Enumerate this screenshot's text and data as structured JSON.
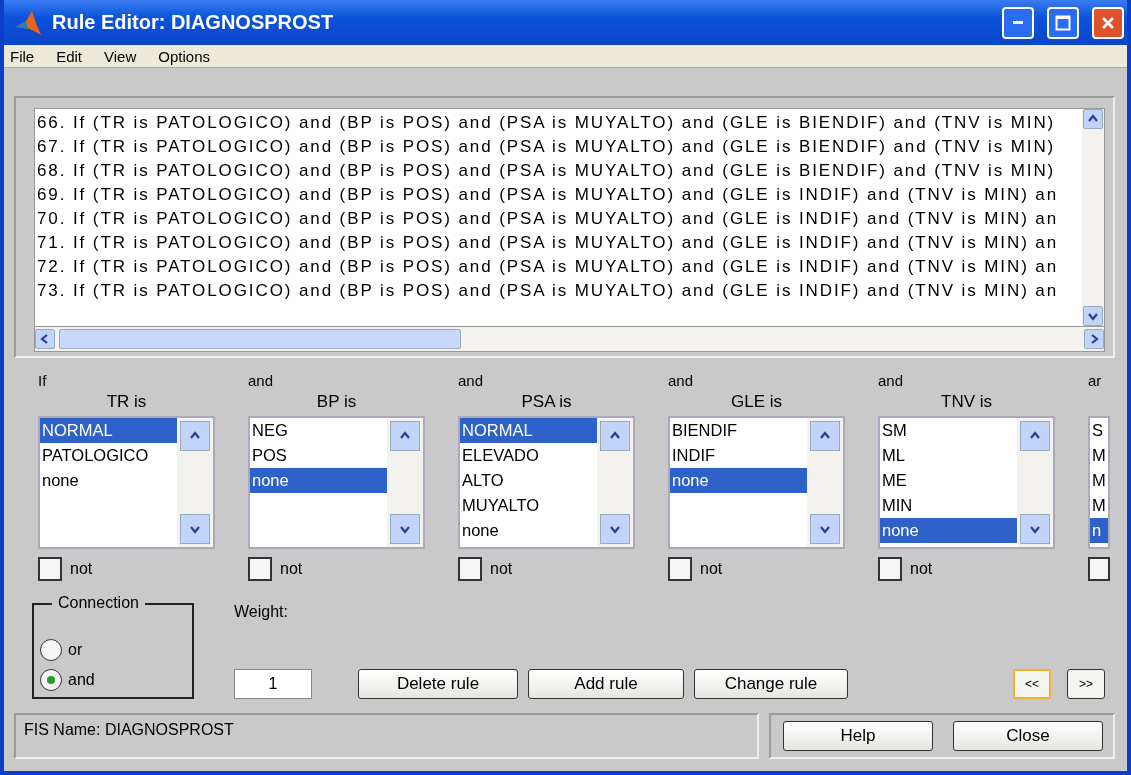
{
  "window": {
    "title": "Rule Editor: DIAGNOSPROST"
  },
  "menu": [
    "File",
    "Edit",
    "View",
    "Options"
  ],
  "rules": [
    "66. If (TR is PATOLOGICO) and (BP is POS) and (PSA is MUYALTO) and (GLE is BIENDIF) and (TNV is MIN)",
    "67. If (TR is PATOLOGICO) and (BP is POS) and (PSA is MUYALTO) and (GLE is BIENDIF) and (TNV is MIN)",
    "68. If (TR is PATOLOGICO) and (BP is POS) and (PSA is MUYALTO) and (GLE is BIENDIF) and (TNV is MIN)",
    "69. If (TR is PATOLOGICO) and (BP is POS) and (PSA is MUYALTO) and (GLE is INDIF) and (TNV is MIN) an",
    "70. If (TR is PATOLOGICO) and (BP is POS) and (PSA is MUYALTO) and (GLE is INDIF) and (TNV is MIN) an",
    "71. If (TR is PATOLOGICO) and (BP is POS) and (PSA is MUYALTO) and (GLE is INDIF) and (TNV is MIN) an",
    "72. If (TR is PATOLOGICO) and (BP is POS) and (PSA is MUYALTO) and (GLE is INDIF) and (TNV is MIN) an",
    "73. If (TR is PATOLOGICO) and (BP is POS) and (PSA is MUYALTO) and (GLE is INDIF) and (TNV is MIN) an"
  ],
  "antecedents": [
    {
      "connector": "If",
      "label": "TR is",
      "items": [
        {
          "text": "NORMAL",
          "selected": true
        },
        {
          "text": "PATOLOGICO",
          "selected": false
        },
        {
          "text": "none",
          "selected": false
        }
      ],
      "negate": {
        "label": "not",
        "checked": false
      }
    },
    {
      "connector": "and",
      "label": "BP is",
      "items": [
        {
          "text": "NEG",
          "selected": false
        },
        {
          "text": "POS",
          "selected": false
        },
        {
          "text": "none",
          "selected": true
        }
      ],
      "negate": {
        "label": "not",
        "checked": false
      }
    },
    {
      "connector": "and",
      "label": "PSA is",
      "items": [
        {
          "text": "NORMAL",
          "selected": true
        },
        {
          "text": "ELEVADO",
          "selected": false
        },
        {
          "text": "ALTO",
          "selected": false
        },
        {
          "text": "MUYALTO",
          "selected": false
        },
        {
          "text": "none",
          "selected": false
        }
      ],
      "negate": {
        "label": "not",
        "checked": false
      }
    },
    {
      "connector": "and",
      "label": "GLE is",
      "items": [
        {
          "text": "BIENDIF",
          "selected": false
        },
        {
          "text": "INDIF",
          "selected": false
        },
        {
          "text": "none",
          "selected": true
        }
      ],
      "negate": {
        "label": "not",
        "checked": false
      }
    },
    {
      "connector": "and",
      "label": "TNV is",
      "items": [
        {
          "text": "SM",
          "selected": false
        },
        {
          "text": "ML",
          "selected": false
        },
        {
          "text": "ME",
          "selected": false
        },
        {
          "text": "MIN",
          "selected": false
        },
        {
          "text": "none",
          "selected": true
        }
      ],
      "negate": {
        "label": "not",
        "checked": false
      }
    },
    {
      "connector": "ar",
      "items": [
        {
          "text": "S",
          "selected": false
        },
        {
          "text": "M",
          "selected": false
        },
        {
          "text": "M",
          "selected": false
        },
        {
          "text": "M",
          "selected": false
        },
        {
          "text": "n",
          "selected": true
        }
      ],
      "negate": {
        "checked": false
      }
    }
  ],
  "connection": {
    "title": "Connection",
    "options": [
      {
        "label": "or",
        "selected": false
      },
      {
        "label": "and",
        "selected": true
      }
    ]
  },
  "weight": {
    "label": "Weight:",
    "value": "1"
  },
  "buttons": [
    "Delete rule",
    "Add rule",
    "Change rule"
  ],
  "nav_buttons": [
    {
      "label": "<<",
      "focused": true
    },
    {
      "label": ">>",
      "focused": false
    }
  ],
  "status": "FIS Name: DIAGNOSPROST",
  "footer_buttons": [
    "Help",
    "Close"
  ]
}
